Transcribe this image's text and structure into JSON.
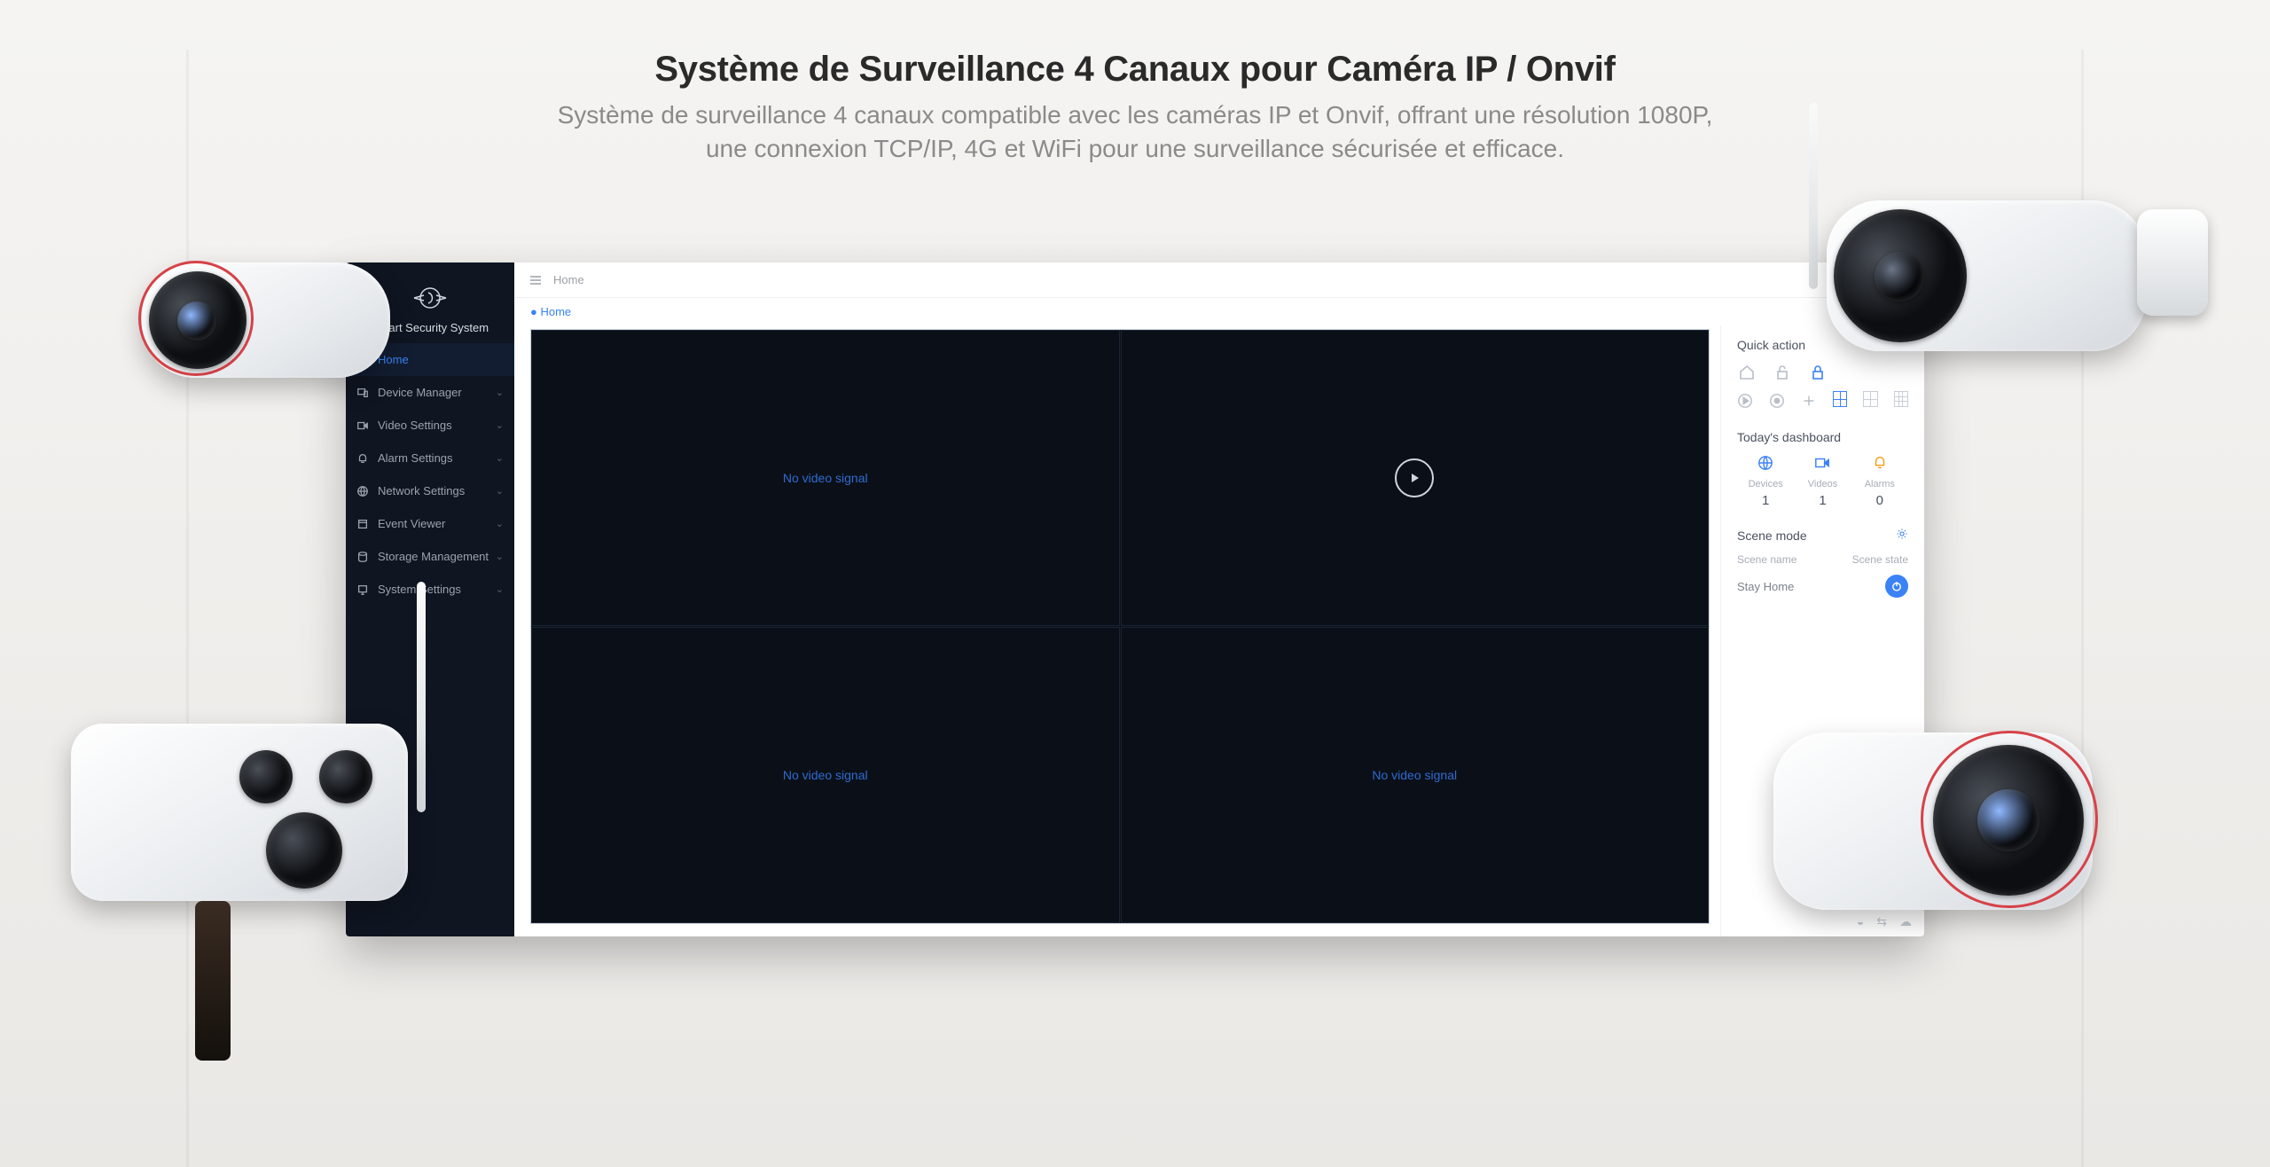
{
  "hero": {
    "title": "Système de Surveillance 4 Canaux pour Caméra IP / Onvif",
    "subtitle_line1": "Système de surveillance 4 canaux compatible avec les caméras IP et Onvif, offrant une résolution 1080P,",
    "subtitle_line2": "une connexion TCP/IP, 4G et WiFi pour une surveillance sécurisée et efficace."
  },
  "app": {
    "brand": "Smart Security System",
    "topbar": {
      "crumb": "Home"
    },
    "breadcrumb": {
      "home": "Home",
      "bullet": "●"
    },
    "nav": [
      {
        "label": "Home",
        "icon": "home",
        "active": true,
        "expandable": false
      },
      {
        "label": "Device Manager",
        "icon": "devices",
        "active": false,
        "expandable": true
      },
      {
        "label": "Video Settings",
        "icon": "video",
        "active": false,
        "expandable": true
      },
      {
        "label": "Alarm Settings",
        "icon": "alarm",
        "active": false,
        "expandable": true
      },
      {
        "label": "Network Settings",
        "icon": "network",
        "active": false,
        "expandable": true
      },
      {
        "label": "Event Viewer",
        "icon": "event",
        "active": false,
        "expandable": true
      },
      {
        "label": "Storage Management",
        "icon": "storage",
        "active": false,
        "expandable": true
      },
      {
        "label": "System Settings",
        "icon": "system",
        "active": false,
        "expandable": true
      }
    ],
    "video_grid": {
      "cells": [
        {
          "state": "no_signal",
          "label": "No video signal"
        },
        {
          "state": "play",
          "label": ""
        },
        {
          "state": "no_signal",
          "label": "No video signal"
        },
        {
          "state": "no_signal",
          "label": "No video signal"
        }
      ]
    },
    "panel": {
      "quick_action": {
        "title": "Quick action",
        "icons_row1": [
          "home-outline",
          "lock-open",
          "lock-closed"
        ],
        "active_row1_index": 2,
        "icons_row2": [
          "play-circle",
          "record-circle",
          "plus",
          "layout-4",
          "layout-6",
          "layout-9"
        ],
        "active_layout": "layout-4"
      },
      "dashboard": {
        "title": "Today's dashboard",
        "cards": [
          {
            "icon": "devices",
            "label": "Devices",
            "value": "1"
          },
          {
            "icon": "videos",
            "label": "Videos",
            "value": "1"
          },
          {
            "icon": "alarms",
            "label": "Alarms",
            "value": "0"
          }
        ]
      },
      "scene": {
        "title": "Scene mode",
        "col_name": "Scene name",
        "col_state": "Scene state",
        "rows": [
          {
            "name": "Stay Home",
            "state_icon": "power-on"
          }
        ]
      }
    },
    "footer_icons": [
      "disk",
      "link",
      "cloud"
    ]
  },
  "colors": {
    "accent": "#3b82f6",
    "warn": "#f39c12",
    "danger": "#d64248",
    "sidebar_bg": "#0f1521"
  }
}
